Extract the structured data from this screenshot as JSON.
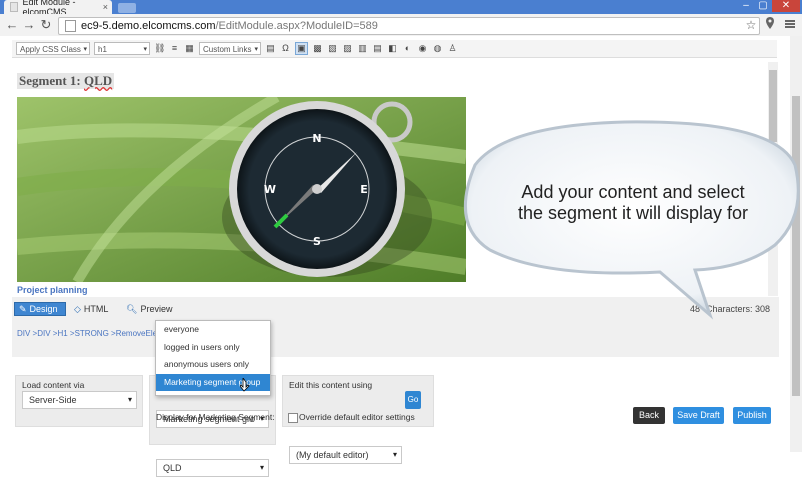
{
  "browser": {
    "tab_title": "Edit Module - elcomCMS",
    "tab_close": "×",
    "url_host": "ec9-5.demo.elcomcms.com",
    "url_path": "/EditModule.aspx?ModuleID=589",
    "back_glyph": "←",
    "forward_glyph": "→",
    "reload_glyph": "↻",
    "star_glyph": "☆",
    "window_minimize": "–",
    "window_maximize": "▢",
    "window_close": "✕"
  },
  "toolbar": {
    "css_class_select": "Apply CSS Class",
    "format_select": "h1",
    "links_select": "Custom Links",
    "icons": [
      "link-icon",
      "align-icon",
      "table-icon",
      "omega-icon",
      "image-icon",
      "media-icon",
      "gallery-icon",
      "flash-icon",
      "document-icon",
      "form-icon",
      "template-icon",
      "circle-icon",
      "play-icon",
      "puzzle-icon",
      "user-icon"
    ]
  },
  "content": {
    "segment_heading_prefix": "Segment 1: ",
    "segment_heading_name": "QLD",
    "image_caption": "Project planning",
    "callout_text_line1": "Add your content and select",
    "callout_text_line2": "the segment it will display for"
  },
  "editor_modes": {
    "design": "Design",
    "html": "HTML",
    "preview": "Preview"
  },
  "editor_stats": {
    "words_partial": "48",
    "characters_label": "Characters: 308"
  },
  "breadcrumb": "DIV >DIV >H1 >STRONG >RemoveElem",
  "load_content": {
    "label": "Load content via",
    "value": "Server-Side"
  },
  "segment": {
    "select_value": "Marketing segment gro",
    "options": [
      "everyone",
      "logged in users only",
      "anonymous users only",
      "Marketing segment group"
    ],
    "selected_index": 3,
    "display_label": "Display for Marketing Segment:",
    "display_value": "QLD"
  },
  "edit_using": {
    "label": "Edit this content using",
    "value": "(My default editor)",
    "go_label": "Go",
    "override_label": "Override default editor settings"
  },
  "actions": {
    "back": "Back",
    "save_draft": "Save Draft",
    "publish": "Publish"
  },
  "colors": {
    "accent": "#2f86d2",
    "titlebar": "#4a7fd0",
    "link": "#4a75c1"
  }
}
